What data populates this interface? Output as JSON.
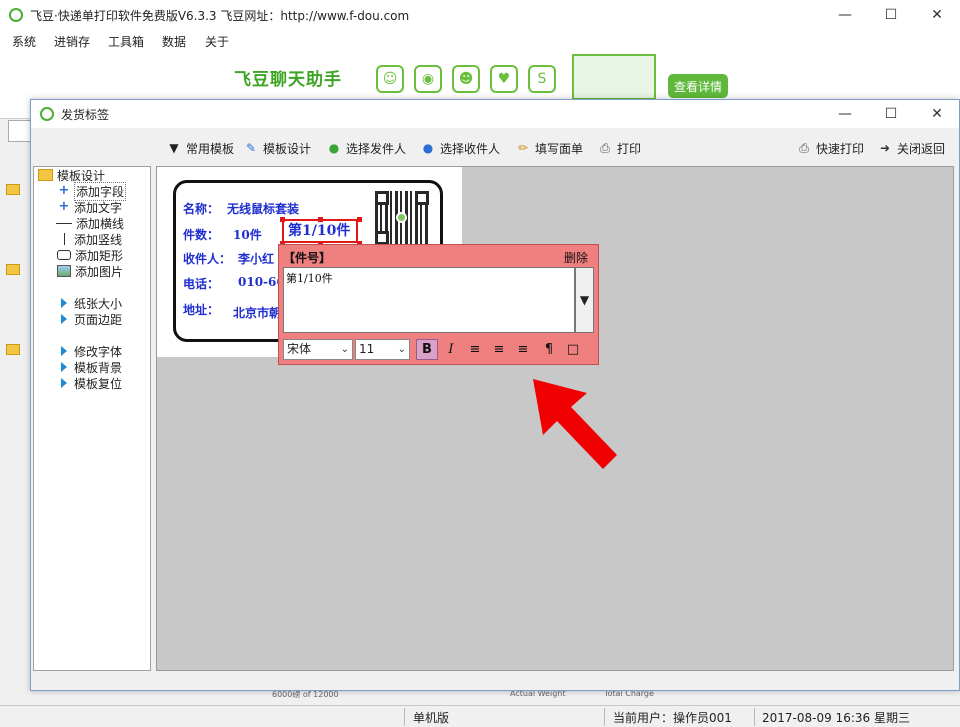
{
  "app": {
    "title": "飞豆·快递单打印软件免费版V6.3.3  飞豆网址：http://www.f-dou.com"
  },
  "menu": [
    "系统",
    "进销存",
    "工具箱",
    "数据",
    "关于"
  ],
  "banner": {
    "title": "飞豆聊天助手",
    "button_label": "查看详情",
    "icons": [
      "qq-icon",
      "wechat-icon",
      "chat-bubble-icon",
      "cow-icon",
      "skype-icon"
    ]
  },
  "dialog": {
    "title": "发货标签",
    "toolbar": {
      "templates": "常用模板",
      "design": "模板设计",
      "sender": "选择发件人",
      "recipient": "选择收件人",
      "fill": "填写面单",
      "print": "打印",
      "quick_print": "快速打印",
      "close_back": "关闭返回"
    },
    "tree": {
      "root": "模板设计",
      "items": [
        "添加字段",
        "添加文字",
        "添加横线",
        "添加竖线",
        "添加矩形",
        "添加图片"
      ],
      "settings": [
        "纸张大小",
        "页面边距"
      ],
      "style": [
        "修改字体",
        "模板背景",
        "模板复位"
      ]
    }
  },
  "label": {
    "name_label": "名称：",
    "name_value": "无线鼠标套装",
    "count_label": "件数：",
    "count_value": "10件",
    "count_box": "第1/10件",
    "recipient_label": "收件人：",
    "recipient_value": "李小红",
    "phone_label": "电话：",
    "phone_value": "010-66",
    "address_label": "地址：",
    "address_value": "北京市朝"
  },
  "editor": {
    "title": "【件号】",
    "delete": "删除",
    "text": "第1/10件",
    "font": "宋体",
    "size": "11",
    "bold": "B",
    "italic": "I"
  },
  "status": {
    "mode": "单机版",
    "user": "当前用户：操作员001",
    "datetime": "2017-08-09 16:36 星期三"
  },
  "background_fragments": {
    "weight_text": "6000磅 of 12000",
    "actual_weight": "Actual Weight",
    "total_charge": "Total Charge"
  },
  "colors": {
    "accent_green": "#5fb83a",
    "label_blue": "#1f2fd0",
    "editor_pink": "#f08080",
    "arrow_red": "#f00000"
  }
}
